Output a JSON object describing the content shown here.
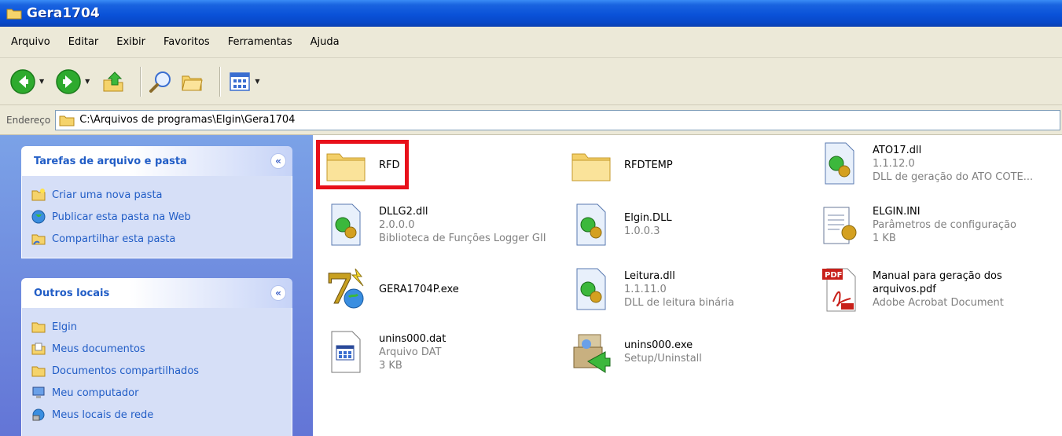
{
  "window": {
    "title": "Gera1704"
  },
  "menu": [
    "Arquivo",
    "Editar",
    "Exibir",
    "Favoritos",
    "Ferramentas",
    "Ajuda"
  ],
  "toolbar": {
    "buttons": [
      "back-icon",
      "forward-icon",
      "up-folder-icon",
      "search-icon",
      "folders-icon",
      "views-icon"
    ]
  },
  "address": {
    "label": "Endereço",
    "path": "C:\\Arquivos de programas\\Elgin\\Gera1704"
  },
  "sidebar": {
    "tasks": {
      "title": "Tarefas de arquivo e pasta",
      "items": [
        "Criar uma nova pasta",
        "Publicar esta pasta na Web",
        "Compartilhar esta pasta"
      ]
    },
    "places": {
      "title": "Outros locais",
      "items": [
        "Elgin",
        "Meus documentos",
        "Documentos compartilhados",
        "Meu computador",
        "Meus locais de rede"
      ]
    }
  },
  "files": [
    {
      "name": "RFD",
      "meta1": "",
      "meta2": "",
      "icon": "folder-icon"
    },
    {
      "name": "RFDTEMP",
      "meta1": "",
      "meta2": "",
      "icon": "folder-icon"
    },
    {
      "name": "ATO17.dll",
      "meta1": "1.1.12.0",
      "meta2": "DLL de geração do ATO COTE...",
      "icon": "dll-icon"
    },
    {
      "name": "DLLG2.dll",
      "meta1": "2.0.0.0",
      "meta2": "Biblioteca de Funções Logger GII",
      "icon": "dll-icon"
    },
    {
      "name": "Elgin.DLL",
      "meta1": "1.0.0.3",
      "meta2": "",
      "icon": "dll-icon"
    },
    {
      "name": "ELGIN.INI",
      "meta1": "Parâmetros de configuração",
      "meta2": "1 KB",
      "icon": "ini-icon"
    },
    {
      "name": "GERA1704P.exe",
      "meta1": "",
      "meta2": "",
      "icon": "exe-icon"
    },
    {
      "name": "Leitura.dll",
      "meta1": "1.1.11.0",
      "meta2": "DLL de leitura binária",
      "icon": "dll-icon"
    },
    {
      "name": "Manual para geração dos",
      "meta1": "arquivos.pdf",
      "meta2": "Adobe Acrobat Document",
      "icon": "pdf-icon"
    },
    {
      "name": "unins000.dat",
      "meta1": "Arquivo DAT",
      "meta2": "3 KB",
      "icon": "dat-icon"
    },
    {
      "name": "unins000.exe",
      "meta1": "Setup/Uninstall",
      "meta2": "",
      "icon": "uninstall-icon"
    }
  ],
  "colors": {
    "titlebar": "#0a52d8",
    "sidebar": "#7ba2e7",
    "link": "#215dc6",
    "highlight": "#e8101a"
  }
}
